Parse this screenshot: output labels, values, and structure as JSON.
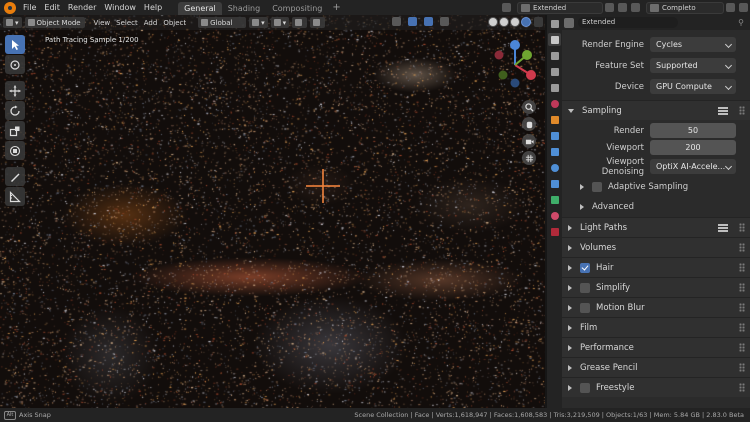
{
  "topbar": {
    "menus": [
      "File",
      "Edit",
      "Render",
      "Window",
      "Help"
    ],
    "workspace_tabs": [
      "General",
      "Shading",
      "Compositing"
    ],
    "active_tab": "General",
    "add_tab": "+",
    "scene_name": "Extended",
    "view_layer_name": "Completo"
  },
  "viewport": {
    "mode": "Object Mode",
    "menus": [
      "View",
      "Select",
      "Add",
      "Object"
    ],
    "transform_orientation": "Global",
    "render_info": "Path Tracing Sample 1/200",
    "active_shading": "rendered"
  },
  "properties": {
    "search_text": "Extended",
    "render_engine_label": "Render Engine",
    "render_engine": "Cycles",
    "feature_set_label": "Feature Set",
    "feature_set": "Supported",
    "device_label": "Device",
    "device": "GPU Compute",
    "sampling_panel": "Sampling",
    "render_label": "Render",
    "render_samples": "50",
    "viewport_label": "Viewport",
    "viewport_samples": "200",
    "denoising_label": "Viewport Denoising",
    "denoising_value": "OptiX AI-Accele...",
    "adaptive_sampling": "Adaptive Sampling",
    "advanced": "Advanced",
    "panels": {
      "light_paths": "Light Paths",
      "volumes": "Volumes",
      "hair": "Hair",
      "simplify": "Simplify",
      "motion_blur": "Motion Blur",
      "film": "Film",
      "performance": "Performance",
      "grease_pencil": "Grease Pencil",
      "freestyle": "Freestyle"
    },
    "checkbox_states": {
      "adaptive_sampling": false,
      "hair": true,
      "simplify": false,
      "motion_blur": false,
      "freestyle": false
    }
  },
  "statusbar": {
    "key_hint": "Alt",
    "action": "Axis Snap",
    "stats": "Scene Collection | Face | Verts:1,618,947 | Faces:1,608,583 | Tris:3,219,509 | Objects:1/63 | Mem: 5.84 GB | 2.83.0 Beta"
  },
  "colors": {
    "accent": "#4772b3",
    "blender_orange": "#e87d0d"
  }
}
